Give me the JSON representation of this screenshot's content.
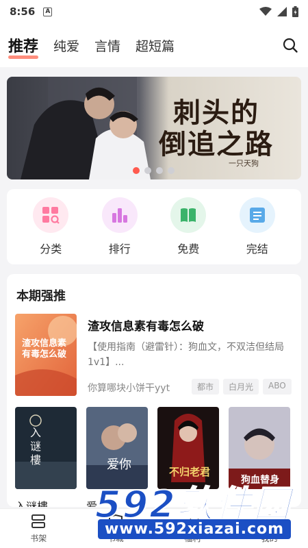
{
  "status": {
    "time": "8:56",
    "a_badge": "A"
  },
  "tabs": [
    {
      "label": "推荐"
    },
    {
      "label": "纯爱"
    },
    {
      "label": "言情"
    },
    {
      "label": "超短篇"
    }
  ],
  "banner": {
    "title_line1": "刺头的",
    "title_line2": "倒追之路",
    "author": "一只天狗",
    "slide_count": 4,
    "active_slide": 1
  },
  "quick_entries": [
    {
      "label": "分类",
      "icon": "category-icon",
      "color": "#ff7aa0",
      "bg": "#ffe9f0"
    },
    {
      "label": "排行",
      "icon": "ranking-icon",
      "color": "#d777e0",
      "bg": "#f9e8fb"
    },
    {
      "label": "免费",
      "icon": "book-icon",
      "color": "#3bb36a",
      "bg": "#e4f6ea"
    },
    {
      "label": "完结",
      "icon": "list-icon",
      "color": "#58a9e8",
      "bg": "#e5f3fd"
    }
  ],
  "section": {
    "title": "本期强推",
    "featured": {
      "title": "渣攻信息素有毒怎么破",
      "desc": "【使用指南（避雷针）：狗血文，不双洁但结局1v1】...",
      "author": "你算哪块小饼干yyt",
      "tags": [
        "都市",
        "白月光",
        "ABO"
      ],
      "cover_text": "渣攻信息素有毒怎么破"
    },
    "covers": [
      {
        "name": "入谜樓",
        "cover_text": "入谜樓"
      },
      {
        "name": "爱",
        "cover_text": "爱你"
      },
      {
        "name": "",
        "cover_text": "不归老君"
      },
      {
        "name": "",
        "cover_text": "狗血替身"
      }
    ]
  },
  "bottom_nav": [
    {
      "label": "书架",
      "icon": "bookshelf-icon"
    },
    {
      "label": "书城",
      "icon": "bookstore-icon"
    },
    {
      "label": "福利",
      "icon": "gift-icon"
    },
    {
      "label": "我的",
      "icon": "profile-icon"
    }
  ],
  "watermark": {
    "logo": "592软件园",
    "url": "www.592xiazai.com"
  }
}
